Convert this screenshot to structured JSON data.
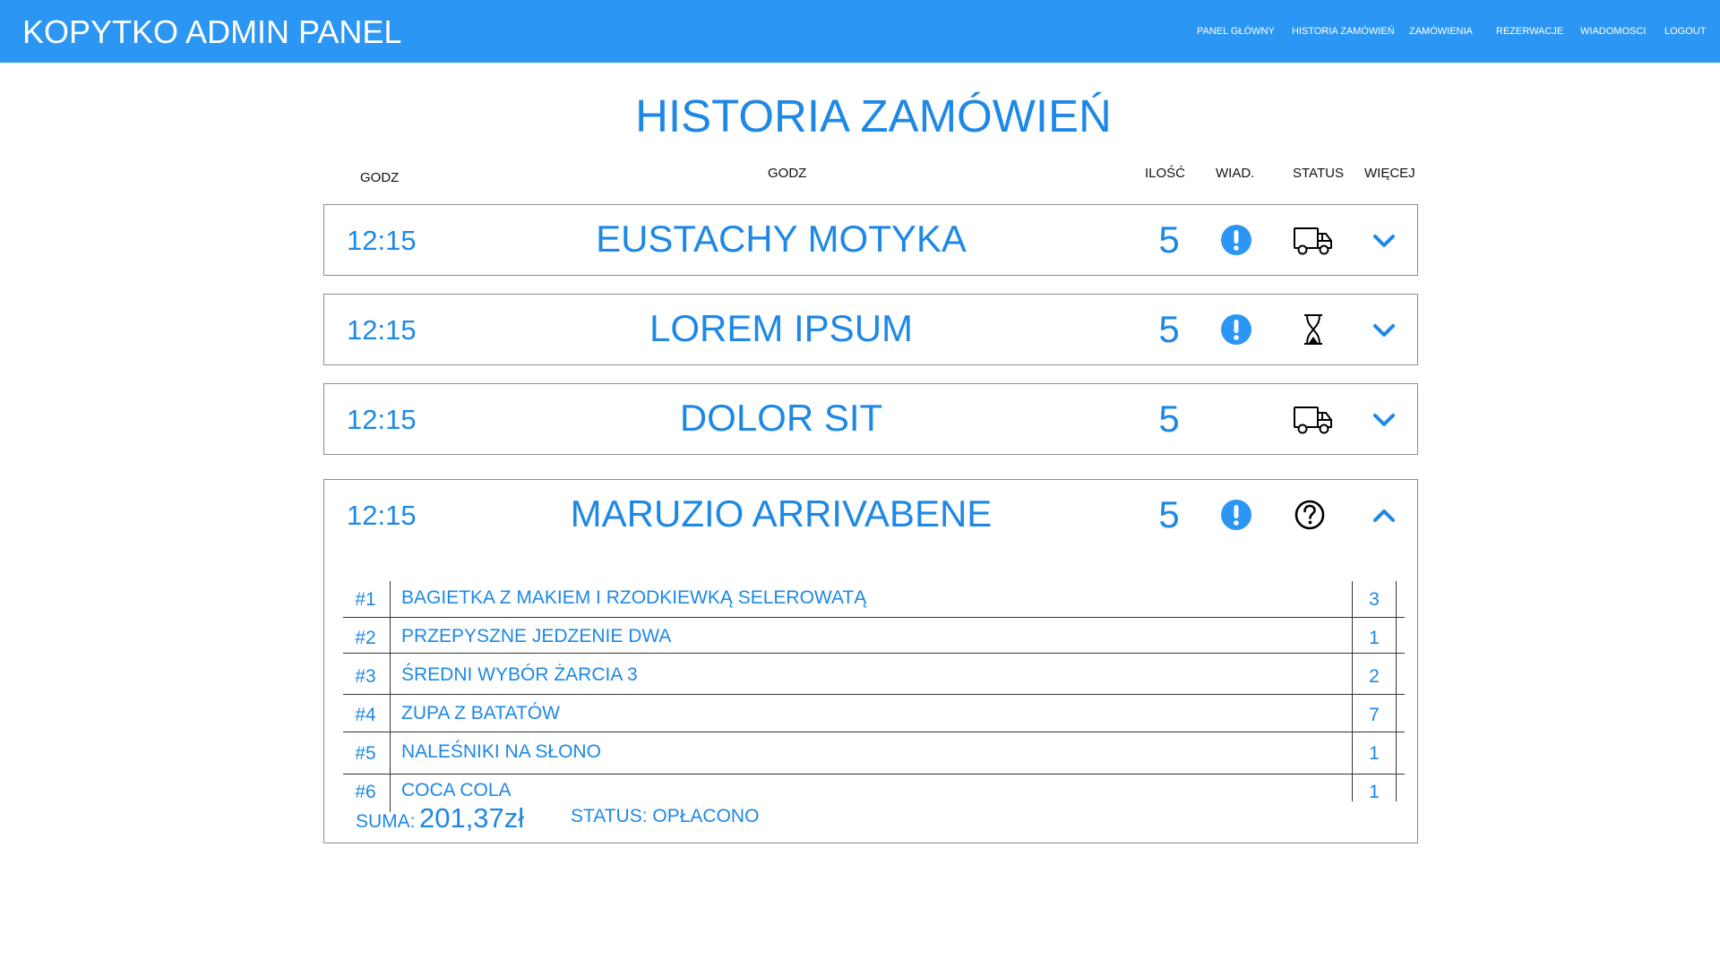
{
  "app": {
    "brand": "KOPYTKO ADMIN PANEL"
  },
  "nav": {
    "items": [
      {
        "label": "PANEL GŁÓWNY"
      },
      {
        "label": "HISTORIA ZAMÓWIEŃ"
      },
      {
        "label": "ZAMÓWIENIA"
      },
      {
        "label": "REZERWACJE"
      },
      {
        "label": "WIADOMOSCI"
      },
      {
        "label": "LOGOUT"
      }
    ]
  },
  "page": {
    "title": "HISTORIA ZAMÓWIEŃ"
  },
  "columns": {
    "time": "GODZ",
    "name": "GODZ",
    "qty": "ILOŚĆ",
    "msg": "WIAD.",
    "status": "STATUS",
    "more": "WIĘCEJ"
  },
  "orders": [
    {
      "time": "12:15",
      "name": "EUSTACHY MOTYKA",
      "qty": "5",
      "message_icon": "exclamation-circle-icon",
      "status_icon": "truck-icon",
      "more_icon": "chevron-down-icon"
    },
    {
      "time": "12:15",
      "name": "LOREM IPSUM",
      "qty": "5",
      "message_icon": "exclamation-circle-icon",
      "status_icon": "hourglass-icon",
      "more_icon": "chevron-down-icon"
    },
    {
      "time": "12:15",
      "name": "DOLOR SIT",
      "qty": "5",
      "message_icon": "",
      "status_icon": "truck-icon",
      "more_icon": "chevron-down-icon"
    },
    {
      "time": "12:15",
      "name": "MARUZIO ARRIVABENE",
      "qty": "5",
      "message_icon": "exclamation-circle-icon",
      "status_icon": "question-circle-icon",
      "more_icon": "chevron-up-icon",
      "items": [
        {
          "num": "#1",
          "name": "BAGIETKA Z MAKIEM I RZODKIEWKĄ SELEROWATĄ",
          "qty": "3"
        },
        {
          "num": "#2",
          "name": "PRZEPYSZNE JEDZENIE DWA",
          "qty": "1"
        },
        {
          "num": "#3",
          "name": "ŚREDNI WYBÓR ŻARCIA 3",
          "qty": "2"
        },
        {
          "num": "#4",
          "name": "ZUPA Z BATATÓW",
          "qty": "7"
        },
        {
          "num": "#5",
          "name": "NALEŚNIKI NA SŁONO",
          "qty": "1"
        },
        {
          "num": "#6",
          "name": "COCA COLA",
          "qty": "1"
        }
      ],
      "sum_label": "SUMA:",
      "sum_value": "201,37zł",
      "payment_status": "STATUS: OPŁACONO"
    }
  ],
  "colors": {
    "accent": "#2b96f3",
    "text_accent": "#1e88e5",
    "border": "#8f8f8f"
  }
}
